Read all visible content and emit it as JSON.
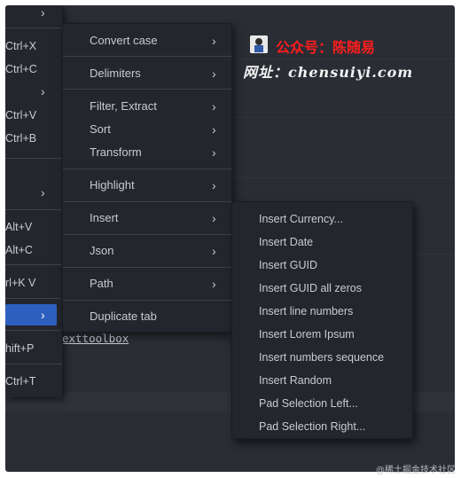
{
  "left_menu": {
    "items": [
      {
        "label": "",
        "has_submenu": true
      },
      {
        "label": "Ctrl+X",
        "has_submenu": false
      },
      {
        "label": "Ctrl+C",
        "has_submenu": false
      },
      {
        "label": "",
        "has_submenu": true
      },
      {
        "label": "Ctrl+V",
        "has_submenu": false
      },
      {
        "label": "Ctrl+B",
        "has_submenu": false
      },
      {
        "label": "",
        "has_submenu": true
      },
      {
        "label": "Alt+V",
        "has_submenu": false
      },
      {
        "label": "Alt+C",
        "has_submenu": false
      },
      {
        "label": "rl+K V",
        "has_submenu": false
      },
      {
        "label": "",
        "has_submenu": true,
        "active": true
      },
      {
        "label": "hift+P",
        "has_submenu": false
      },
      {
        "label": "Ctrl+T",
        "has_submenu": false
      }
    ]
  },
  "main_menu": {
    "items": [
      {
        "label": "Convert case",
        "has_submenu": true
      },
      {
        "label": "Delimiters",
        "has_submenu": true
      },
      {
        "label": "Filter, Extract",
        "has_submenu": true
      },
      {
        "label": "Sort",
        "has_submenu": true
      },
      {
        "label": "Transform",
        "has_submenu": true
      },
      {
        "label": "Highlight",
        "has_submenu": true
      },
      {
        "label": "Insert",
        "has_submenu": true
      },
      {
        "label": "Json",
        "has_submenu": true
      },
      {
        "label": "Path",
        "has_submenu": true
      },
      {
        "label": "Duplicate tab",
        "has_submenu": false
      }
    ]
  },
  "insert_submenu": {
    "items": [
      {
        "label": "Insert Currency..."
      },
      {
        "label": "Insert Date"
      },
      {
        "label": "Insert GUID"
      },
      {
        "label": "Insert GUID all zeros"
      },
      {
        "label": "Insert line numbers"
      },
      {
        "label": "Insert Lorem Ipsum"
      },
      {
        "label": "Insert numbers sequence"
      },
      {
        "label": "Insert Random"
      },
      {
        "label": "Pad Selection Left..."
      },
      {
        "label": "Pad Selection Right..."
      }
    ]
  },
  "editor": {
    "text": "exttoolbox"
  },
  "watermark": {
    "line1": "公众号：陈随易",
    "line2": "网址：chensuiyi.com",
    "corner": "@稀土掘金技术社区"
  },
  "colors": {
    "menu_bg": "#24262d",
    "editor_bg": "#2b2d35",
    "active_item": "#2d5fbf",
    "text": "#c8cbd2",
    "watermark_red": "#ff1d1d"
  },
  "icons": {
    "submenu_arrow": "chevron-right-icon"
  }
}
